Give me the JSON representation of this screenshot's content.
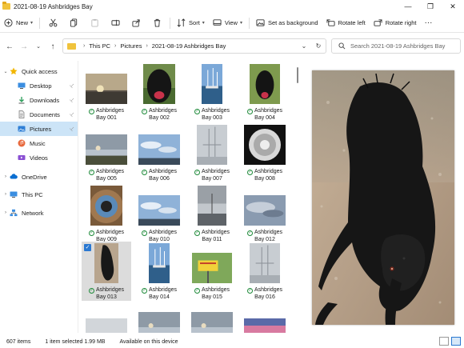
{
  "window": {
    "title": "2021-08-19 Ashbridges Bay",
    "controls": [
      "—",
      "❐",
      "✕"
    ]
  },
  "toolbar": {
    "new_label": "New",
    "sort_label": "Sort",
    "view_label": "View",
    "set_background_label": "Set as background",
    "rotate_left_label": "Rotate left",
    "rotate_right_label": "Rotate right",
    "more_label": "···"
  },
  "address": {
    "crumbs": [
      "This PC",
      "Pictures",
      "2021-08-19 Ashbridges Bay"
    ],
    "search_placeholder": "Search 2021-08-19 Ashbridges Bay"
  },
  "sidebar": {
    "items": [
      {
        "label": "Quick access",
        "icon": "star-icon",
        "level": 0,
        "expandable": true,
        "expanded": true
      },
      {
        "label": "Desktop",
        "icon": "desktop-icon",
        "level": 1,
        "pinned": true
      },
      {
        "label": "Downloads",
        "icon": "download-icon",
        "level": 1,
        "pinned": true
      },
      {
        "label": "Documents",
        "icon": "document-icon",
        "level": 1,
        "pinned": true
      },
      {
        "label": "Pictures",
        "icon": "pictures-icon",
        "level": 1,
        "pinned": true,
        "selected": true
      },
      {
        "label": "Music",
        "icon": "music-icon",
        "level": 1
      },
      {
        "label": "Videos",
        "icon": "video-icon",
        "level": 1
      },
      {
        "label": "OneDrive",
        "icon": "cloud-icon",
        "level": 0,
        "expandable": true
      },
      {
        "label": "This PC",
        "icon": "computer-icon",
        "level": 0,
        "expandable": true
      },
      {
        "label": "Network",
        "icon": "network-icon",
        "level": 0,
        "expandable": true
      }
    ]
  },
  "files": [
    {
      "name": "Ashbridges Bay 001",
      "line1": "Ashbridges",
      "line2": "Bay 001",
      "kind": "sunset"
    },
    {
      "name": "Ashbridges Bay 002",
      "line1": "Ashbridges",
      "line2": "Bay 002",
      "kind": "dog-portrait"
    },
    {
      "name": "Ashbridges Bay 003",
      "line1": "Ashbridges",
      "line2": "Bay 003",
      "kind": "marina"
    },
    {
      "name": "Ashbridges Bay 004",
      "line1": "Ashbridges",
      "line2": "Bay 004",
      "kind": "dog-grass"
    },
    {
      "name": "Ashbridges Bay 005",
      "line1": "Ashbridges",
      "line2": "Bay 005",
      "kind": "shore"
    },
    {
      "name": "Ashbridges Bay 006",
      "line1": "Ashbridges",
      "line2": "Bay 006",
      "kind": "sky-blue"
    },
    {
      "name": "Ashbridges Bay 007",
      "line1": "Ashbridges",
      "line2": "Bay 007",
      "kind": "grey-masts"
    },
    {
      "name": "Ashbridges Bay 008",
      "line1": "Ashbridges",
      "line2": "Bay 008",
      "kind": "dandelion"
    },
    {
      "name": "Ashbridges Bay 009",
      "line1": "Ashbridges",
      "line2": "Bay 009",
      "kind": "eye"
    },
    {
      "name": "Ashbridges Bay 010",
      "line1": "Ashbridges",
      "line2": "Bay 010",
      "kind": "sky-blue"
    },
    {
      "name": "Ashbridges Bay 011",
      "line1": "Ashbridges",
      "line2": "Bay 011",
      "kind": "grey-tall"
    },
    {
      "name": "Ashbridges Bay 012",
      "line1": "Ashbridges",
      "line2": "Bay 012",
      "kind": "clouds"
    },
    {
      "name": "Ashbridges Bay 013",
      "line1": "Ashbridges",
      "line2": "Bay 013",
      "kind": "wet-dog",
      "selected": true
    },
    {
      "name": "Ashbridges Bay 014",
      "line1": "Ashbridges",
      "line2": "Bay 014",
      "kind": "marina"
    },
    {
      "name": "Ashbridges Bay 015",
      "line1": "Ashbridges",
      "line2": "Bay 015",
      "kind": "sign"
    },
    {
      "name": "Ashbridges Bay 016",
      "line1": "Ashbridges",
      "line2": "Bay 016",
      "kind": "grey-masts"
    },
    {
      "name": "",
      "line1": "",
      "line2": "",
      "kind": "grey-fog"
    },
    {
      "name": "",
      "line1": "",
      "line2": "",
      "kind": "shore"
    },
    {
      "name": "",
      "line1": "",
      "line2": "",
      "kind": "shore"
    },
    {
      "name": "",
      "line1": "",
      "line2": "",
      "kind": "pink-sky"
    }
  ],
  "status": {
    "item_count": "607 items",
    "selection": "1 item selected  1.99 MB",
    "availability": "Available on this device"
  },
  "colors": {
    "accent": "#2a78d1",
    "selected_nav": "#cce4f7",
    "sync_ok": "#1f8a3a",
    "folder": "#f0c33c"
  }
}
